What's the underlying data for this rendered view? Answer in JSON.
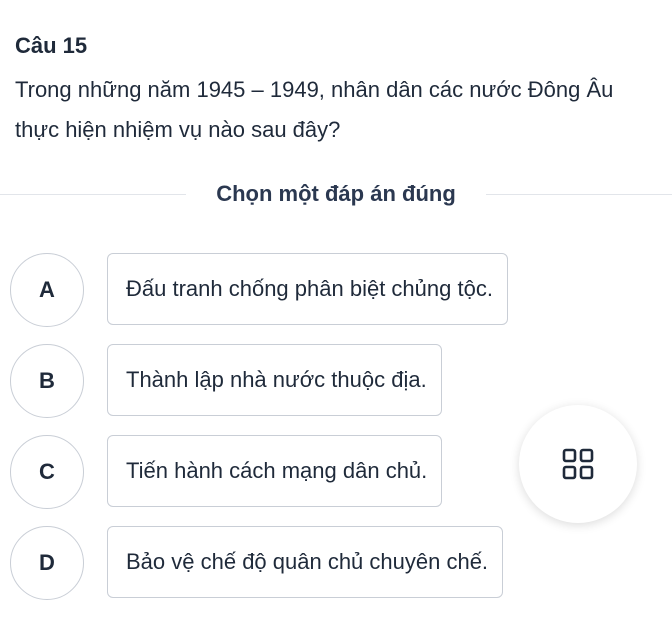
{
  "question": {
    "number_label": "Câu 15",
    "text": "Trong những năm 1945 – 1949, nhân dân các nước Đông Âu thực hiện nhiệm vụ nào sau đây?"
  },
  "instruction": "Chọn một đáp án đúng",
  "options": [
    {
      "letter": "A",
      "text": "Đấu tranh chống phân biệt chủng tộc."
    },
    {
      "letter": "B",
      "text": "Thành lập nhà nước thuộc địa."
    },
    {
      "letter": "C",
      "text": "Tiến hành cách mạng dân chủ."
    },
    {
      "letter": "D",
      "text": "Bảo vệ chế độ quân chủ chuyên chế."
    }
  ],
  "menu_button": {
    "icon": "grid-icon"
  },
  "colors": {
    "text": "#1f2a3a",
    "border": "#c9ced6",
    "divider": "#e2e5ea"
  }
}
